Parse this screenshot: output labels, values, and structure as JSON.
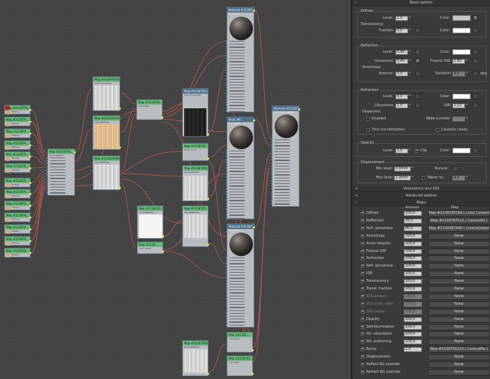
{
  "panel": {
    "basic_title": "Basic options",
    "diffuse": {
      "title": "Diffuse",
      "level_label": "Level:",
      "level": "1,0",
      "color_label": "Color:",
      "color": "#c8c8c8"
    },
    "translucency": {
      "title": "Translucency",
      "fraction_label": "Fraction:",
      "fraction": "0,0",
      "color_label": "Color:",
      "color": "#ffffff"
    },
    "reflection": {
      "title": "Reflection",
      "level_label": "Level:",
      "level": "0,45",
      "color_label": "Color:",
      "color": "#ffffff",
      "gloss_label": "Glossiness:",
      "gloss": "0,45",
      "fresnel_label": "Fresnel IOR:",
      "fresnel": "1,65",
      "aniso_title": "Anisotropy",
      "amount_label": "Amount:",
      "amount": "0,0",
      "rotation_label": "Rotation:",
      "rotation": "0,0",
      "deg": "deg."
    },
    "refraction": {
      "title": "Refraction",
      "level_label": "Level:",
      "level": "0,0",
      "color_label": "Color:",
      "color": "#ffffff",
      "gloss_label": "Glossiness:",
      "gloss": "1,0",
      "ior_label": "IOR:",
      "ior": "1,52",
      "dispersion_title": "Dispersion",
      "enabled": "Enabled",
      "abbe_label": "Abbe number:",
      "abbe": "",
      "thin": "Thin (no refraction)",
      "caustics": "Caustics (slow)"
    },
    "opacity": {
      "title": "Opacity",
      "level_label": "Level:",
      "level": "1,0",
      "clip": "Clip",
      "color_label": "Color:",
      "color": "#ffffff"
    },
    "displacement": {
      "title": "Displacement",
      "min_label": "Min level:",
      "min": "0,0mm",
      "texture_label": "Texture:",
      "max_label": "Max level:",
      "max": "1,0mm",
      "water_label": "Water lvl.:",
      "water": "0,0"
    },
    "vol_title": "Volumetrics and SSS",
    "adv_title": "Advanced options",
    "maps_title": "Maps",
    "maps_head": {
      "amount": "Amount",
      "map": "Map"
    },
    "maps": [
      {
        "name": "Diffuse",
        "amount": "100,0",
        "map": "Map #2138795184  ( Color Correction )",
        "dim": false
      },
      {
        "name": "Reflection",
        "amount": "35,0",
        "map": "Map #2138787512  ( CoronaAO )",
        "dim": false
      },
      {
        "name": "Refl. glossiness",
        "amount": "80,0",
        "map": "Map #2138387496  ( CoronaOutput )",
        "dim": false
      },
      {
        "name": "Anisotropy",
        "amount": "100,0",
        "map": "None",
        "dim": false
      },
      {
        "name": "Aniso rotation",
        "amount": "100,0",
        "map": "None",
        "dim": false
      },
      {
        "name": "Fresnel IOR",
        "amount": "100,0",
        "map": "None",
        "dim": false
      },
      {
        "name": "Refraction",
        "amount": "100,0",
        "map": "None",
        "dim": false
      },
      {
        "name": "Refr. glossiness",
        "amount": "100,0",
        "map": "None",
        "dim": false
      },
      {
        "name": "IOR",
        "amount": "100,0",
        "map": "None",
        "dim": false
      },
      {
        "name": "Translucency",
        "amount": "100,0",
        "map": "None",
        "dim": false
      },
      {
        "name": "Transl. fraction",
        "amount": "100,0",
        "map": "None",
        "dim": false
      },
      {
        "name": "SSS amount",
        "amount": "100,0",
        "map": "None",
        "dim": true
      },
      {
        "name": "SSS scatt. color",
        "amount": "100,0",
        "map": "None",
        "dim": true
      },
      {
        "name": "SSS radius",
        "amount": "100,0",
        "map": "None",
        "dim": true
      },
      {
        "name": "Opacity",
        "amount": "100,0",
        "map": "None",
        "dim": false
      },
      {
        "name": "Self-Illumination",
        "amount": "100,0",
        "map": "None",
        "dim": false
      },
      {
        "name": "Vol. absorption",
        "amount": "100,0",
        "map": "None",
        "dim": false
      },
      {
        "name": "Vol. scattering",
        "amount": "100,0",
        "map": "None",
        "dim": false
      },
      {
        "name": "Bump",
        "amount": "1,0",
        "map": "Map #2138795210  ( CoronaMix )",
        "dim": false
      },
      {
        "name": "Displacement",
        "amount": "",
        "map": "None",
        "dim": false
      },
      {
        "name": "Reflect BG override",
        "amount": "",
        "map": "None",
        "dim": false
      },
      {
        "name": "Refract BG override",
        "amount": "",
        "map": "None",
        "dim": false
      }
    ]
  },
  "graph": {
    "bitmap_nodes": [
      {
        "title": "Map #2138795..."
      },
      {
        "title": "Map #213879..."
      },
      {
        "title": "Map #213879..."
      },
      {
        "title": "Map #213879..."
      },
      {
        "title": "Map #213879..."
      },
      {
        "title": "Map #213879..."
      },
      {
        "title": "Map #213879..."
      },
      {
        "title": "Map #213879..."
      },
      {
        "title": "Map #213879..."
      },
      {
        "title": "Map #213879..."
      },
      {
        "title": "Map #213879..."
      },
      {
        "title": "Map #213879..."
      },
      {
        "title": "Map #213879..."
      }
    ],
    "bitmap_sub": "Bitmap",
    "multitex": {
      "title": "Map #2138795...",
      "sub": "CoronaMultiT..."
    },
    "color_corr_a": {
      "title": "Map #2138795000",
      "sub": "Color Correction"
    },
    "wood_light": {
      "title": "Map #2138795000",
      "sub": "CoronaBitmap"
    },
    "wood_grey": {
      "title": "Map #2138795000",
      "sub": "CoronaBitmap"
    },
    "ao_node": {
      "title": "Map #2138795...",
      "sub": "CoronaAO"
    },
    "cc_dark": {
      "title": "Map #21387951...",
      "sub": "Color Correction"
    },
    "cc_node2": {
      "title": "Map #2138795...",
      "sub": "Color Corre..."
    },
    "out_node": {
      "title": "Map #21387960...",
      "sub": "CoronaOutput"
    },
    "white_tex": {
      "title": "Map #2138795...",
      "sub": "CoronaBitmap"
    },
    "grey_tex": {
      "title": "Map #2138795...",
      "sub": "CoronaBitmap"
    },
    "mat_top": {
      "title": "Material #21387...",
      "sub": "CoronaMtl"
    },
    "mat_mid": {
      "title": "Multi_Mtl",
      "sub": "CoronaMtl"
    },
    "mat_bot": {
      "title": "Material #21387...",
      "sub": "CoronaMtl"
    },
    "layered": {
      "title": "Material #21387...",
      "sub": "CoronaLayeredMtl"
    },
    "mix_small": {
      "title": "Map #2138...",
      "sub": "Color Corre..."
    },
    "mix_node": {
      "title": "Map #21387...",
      "sub": "CoronaMix"
    },
    "bump_node": {
      "title": "Map #2138795...",
      "sub": "CoronaAO"
    },
    "bump_tex": {
      "title": "Map #2138795000",
      "sub": "CoronaBitmap"
    }
  }
}
